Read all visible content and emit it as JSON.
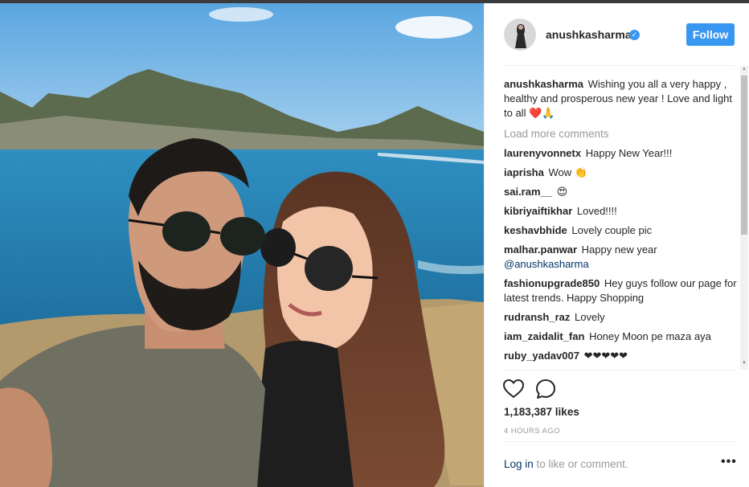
{
  "post": {
    "username": "anushkasharma",
    "follow_label": "Follow",
    "verified_mark": "✓"
  },
  "caption": {
    "username": "anushkasharma",
    "text": "Wishing you all a very happy , healthy and prosperous new year ! Love and light to all ❤️🙏"
  },
  "load_more_label": "Load more comments",
  "comments": [
    {
      "user": "laurenyvonnetx",
      "text": "Happy New Year!!!"
    },
    {
      "user": "iaprisha",
      "text": "Wow 👏"
    },
    {
      "user": "sai.ram__",
      "text": "😍"
    },
    {
      "user": "kibriyaiftikhar",
      "text": "Loved!!!!"
    },
    {
      "user": "keshavbhide",
      "text": "Lovely couple pic"
    },
    {
      "user": "malhar.panwar",
      "text": "Happy new year",
      "mention": "@anushkasharma"
    },
    {
      "user": "fashionupgrade850",
      "text": "Hey guys follow our page for latest trends. Happy Shopping"
    },
    {
      "user": "rudransh_raz",
      "text": "Lovely"
    },
    {
      "user": "iam_zaidalit_fan",
      "text": "Honey Moon pe maza aya"
    },
    {
      "user": "ruby_yadav007",
      "text": "❤❤❤❤❤"
    }
  ],
  "likes": "1,183,387 likes",
  "time": "4 HOURS AGO",
  "footer": {
    "login": "Log in",
    "rest": " to like or comment.",
    "more": "•••"
  },
  "icons": {
    "like": "heart-icon",
    "comment": "comment-bubble-icon",
    "verified": "verified-badge-icon",
    "more": "more-options-icon"
  },
  "colors": {
    "accent": "#3897f0",
    "link": "#003569",
    "muted": "#999999"
  }
}
